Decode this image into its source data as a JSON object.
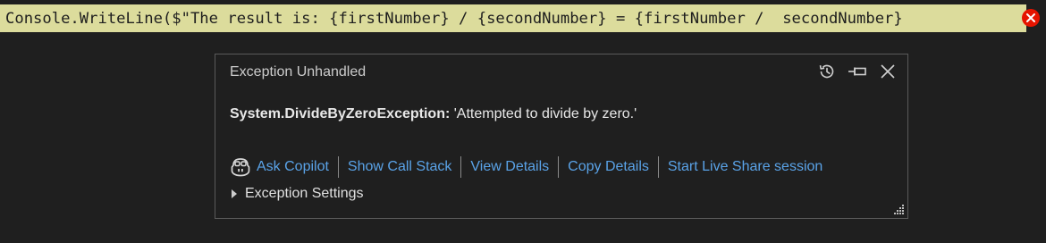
{
  "editor": {
    "code_line": "Console.WriteLine($\"The result is: {firstNumber} / {secondNumber} = {firstNumber /  secondNumber}"
  },
  "popup": {
    "title": "Exception Unhandled",
    "exception_type": "System.DivideByZeroException:",
    "exception_message": " 'Attempted to divide by zero.'",
    "links": {
      "ask_copilot": "Ask Copilot",
      "show_call_stack": "Show Call Stack",
      "view_details": "View Details",
      "copy_details": "Copy Details",
      "live_share": "Start Live Share session"
    },
    "settings_label": "Exception Settings",
    "icons": {
      "history": "history-icon",
      "pin": "pin-icon",
      "close": "close-icon",
      "copilot": "copilot-icon",
      "error": "error-icon",
      "resize": "resize-grip-icon"
    }
  },
  "colors": {
    "background": "#1f1f1f",
    "highlight": "#dcdc9c",
    "link": "#5aa3e8",
    "error": "#e51400",
    "border": "#5a5a5a"
  }
}
